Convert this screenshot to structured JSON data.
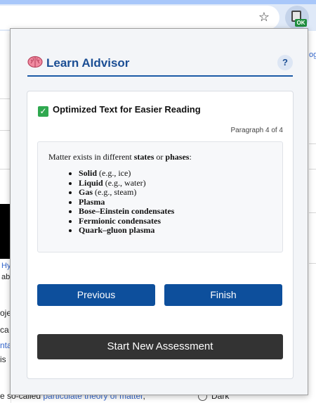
{
  "browser": {
    "star_icon": "star-icon",
    "extension": {
      "icon": "extension-icon",
      "badge": "OK"
    }
  },
  "background_page": {
    "fragments": {
      "right_top": "og",
      "hy": "Hy",
      "ab": "ab",
      "oje": "oje",
      "ca": "ca",
      "nta": "nta",
      "is": "is",
      "bottom_prefix": "e so-called ",
      "bottom_link": "particulate theory of matter",
      "bottom_suffix": ",",
      "dark_label": "Dark"
    }
  },
  "popup": {
    "app_icon": "brain-icon",
    "title": "Learn AIdvisor",
    "help_label": "?",
    "card": {
      "heading_icon": "check-icon",
      "heading": "Optimized Text for Easier Reading",
      "paragraph_counter": "Paragraph 4 of 4",
      "intro": {
        "part1": "Matter exists in different ",
        "bold1": "states",
        "part2": " or ",
        "bold2": "phases",
        "part3": ":"
      },
      "phases": [
        {
          "name": "Solid",
          "example": " (e.g., ice)"
        },
        {
          "name": "Liquid",
          "example": " (e.g., water)"
        },
        {
          "name": "Gas",
          "example": " (e.g., steam)"
        },
        {
          "name": "Plasma",
          "example": ""
        },
        {
          "name": "Bose–Einstein condensates",
          "example": ""
        },
        {
          "name": "Fermionic condensates",
          "example": ""
        },
        {
          "name": "Quark–gluon plasma",
          "example": ""
        }
      ],
      "previous_label": "Previous",
      "finish_label": "Finish"
    },
    "new_assessment_label": "Start New Assessment"
  },
  "colors": {
    "brand_blue": "#1b4e94",
    "button_blue": "#0d4f9c",
    "dark_button": "#333333",
    "check_green": "#2fa84f"
  }
}
